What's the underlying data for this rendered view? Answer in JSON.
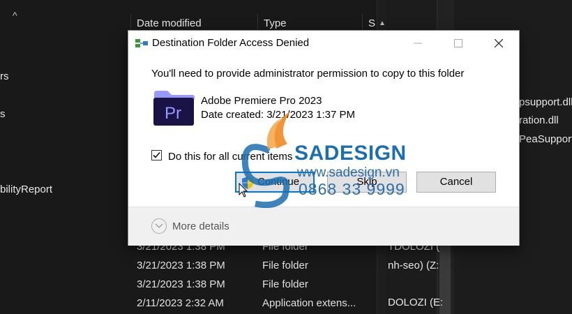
{
  "background": {
    "columns": {
      "date_modified": "Date modified",
      "type": "Type",
      "size_partial": "S"
    },
    "left_items": [
      "rs",
      "s",
      "bilityReport"
    ],
    "right_files": [
      "psupport.dll",
      "ration.dll",
      "PeaSupport."
    ],
    "drives": [
      "TDOLOZI (",
      "nh-seo) (Z:",
      "DOLOZI (E:"
    ],
    "rows": [
      {
        "date": "3/21/2023 1:38 PM",
        "type": "File folder"
      },
      {
        "date": "3/21/2023 1:38 PM",
        "type": "File folder"
      },
      {
        "date": "3/21/2023 1:38 PM",
        "type": "File folder"
      },
      {
        "date": "2/11/2023 2:32 AM",
        "type": "Application extens..."
      }
    ]
  },
  "dialog": {
    "title": "Destination Folder Access Denied",
    "message": "You'll need to provide administrator permission to copy to this folder",
    "item": {
      "icon": "premiere-pro-folder-icon",
      "icon_text": "Pr",
      "name": "Adobe Premiere Pro 2023",
      "date_created": "Date created: 3/21/2023 1:37 PM"
    },
    "checkbox": {
      "label": "Do this for all current items",
      "checked": true
    },
    "buttons": {
      "continue": "Continue",
      "skip": "Skip",
      "cancel": "Cancel"
    },
    "more_details": "More details"
  },
  "watermark": {
    "brand": "SADESIGN",
    "url": "www.sadesign.vn",
    "phone": "0868 33 9999"
  },
  "colors": {
    "dark_bg": "#191919",
    "accent_blue": "#0078d7",
    "premiere_purple": "#9999ff",
    "premiere_dark": "#1a1446",
    "watermark_blue": "#1b6fb0",
    "watermark_orange": "#f08a24"
  }
}
